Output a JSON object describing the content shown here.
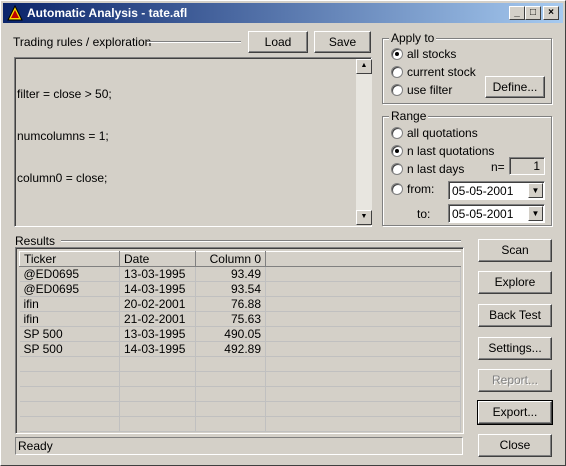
{
  "window": {
    "title": "Automatic Analysis - tate.afl",
    "controls": {
      "minimize": "_",
      "maximize": "□",
      "close": "×"
    }
  },
  "editor": {
    "label": "Trading rules / exploration",
    "load_label": "Load",
    "save_label": "Save",
    "lines": [
      "filter = close > 50;",
      "numcolumns = 1;",
      "column0 = close;"
    ]
  },
  "apply_to": {
    "label": "Apply to",
    "options": [
      "all stocks",
      "current stock",
      "use filter"
    ],
    "selected": 0,
    "define_label": "Define..."
  },
  "range": {
    "label": "Range",
    "options": [
      "all quotations",
      "n last quotations",
      "n last days",
      "from:"
    ],
    "selected": 1,
    "n_label": "n=",
    "n_value": "1",
    "from_value": "05-05-2001",
    "to_label": "to:",
    "to_value": "05-05-2001"
  },
  "results": {
    "label": "Results",
    "columns": [
      "Ticker",
      "Date",
      "Column 0"
    ],
    "rows": [
      [
        "@ED0695",
        "13-03-1995",
        "93.49"
      ],
      [
        "@ED0695",
        "14-03-1995",
        "93.54"
      ],
      [
        "ifin",
        "20-02-2001",
        "76.88"
      ],
      [
        "ifin",
        "21-02-2001",
        "75.63"
      ],
      [
        "SP 500",
        "13-03-1995",
        "490.05"
      ],
      [
        "SP 500",
        "14-03-1995",
        "492.89"
      ]
    ]
  },
  "actions": {
    "scan": "Scan",
    "explore": "Explore",
    "backtest": "Back Test",
    "settings": "Settings...",
    "report": "Report...",
    "export": "Export...",
    "close": "Close"
  },
  "status": {
    "text": "Ready"
  }
}
